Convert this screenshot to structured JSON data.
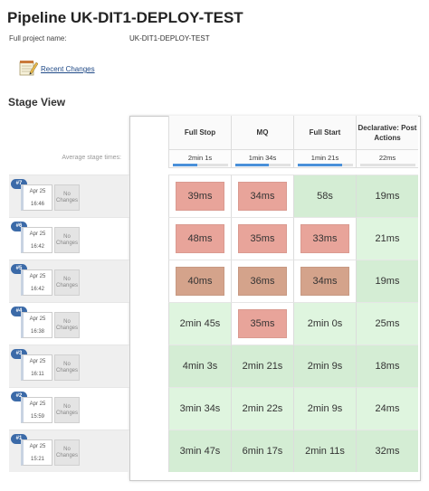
{
  "page": {
    "title": "Pipeline UK-DIT1-DEPLOY-TEST",
    "full_name_label": "Full project name:",
    "full_name_value": "UK-DIT1-DEPLOY-TEST",
    "recent_changes": "Recent Changes",
    "recent_changes_icon": "notepad-pencil-icon",
    "stage_view_heading": "Stage View",
    "avg_stage_times_label": "Average stage times:"
  },
  "colors": {
    "success": "#dff5df",
    "unstable": "#e8a49a",
    "unstable_dim": "#d4a38b",
    "progress": "#4a90d9",
    "build_badge": "#3b6aa8"
  },
  "stages": [
    {
      "name": "Full Stop",
      "avg": "2min 1s",
      "avg_fill": 0.45
    },
    {
      "name": "MQ",
      "avg": "1min 34s",
      "avg_fill": 0.6
    },
    {
      "name": "Full Start",
      "avg": "1min 21s",
      "avg_fill": 0.8
    },
    {
      "name": "Declarative: Post Actions",
      "avg": "22ms",
      "avg_fill": 0.0
    }
  ],
  "builds": [
    {
      "number": "#7",
      "date": "Apr 25",
      "time": "16:46",
      "changes": "No Changes",
      "cells": [
        {
          "value": "39ms",
          "status": "unstable"
        },
        {
          "value": "34ms",
          "status": "unstable"
        },
        {
          "value": "58s",
          "status": "success"
        },
        {
          "value": "19ms",
          "status": "success"
        }
      ]
    },
    {
      "number": "#6",
      "date": "Apr 25",
      "time": "16:42",
      "changes": "No Changes",
      "cells": [
        {
          "value": "48ms",
          "status": "unstable"
        },
        {
          "value": "35ms",
          "status": "unstable"
        },
        {
          "value": "33ms",
          "status": "unstable"
        },
        {
          "value": "21ms",
          "status": "success"
        }
      ]
    },
    {
      "number": "#5",
      "date": "Apr 25",
      "time": "16:42",
      "changes": "No Changes",
      "cells": [
        {
          "value": "40ms",
          "status": "unstable-dim"
        },
        {
          "value": "36ms",
          "status": "unstable-dim"
        },
        {
          "value": "34ms",
          "status": "unstable-dim"
        },
        {
          "value": "19ms",
          "status": "success"
        }
      ]
    },
    {
      "number": "#4",
      "date": "Apr 25",
      "time": "16:38",
      "changes": "No Changes",
      "cells": [
        {
          "value": "2min 45s",
          "status": "success"
        },
        {
          "value": "35ms",
          "status": "unstable"
        },
        {
          "value": "2min 0s",
          "status": "success"
        },
        {
          "value": "25ms",
          "status": "success"
        }
      ]
    },
    {
      "number": "#3",
      "date": "Apr 25",
      "time": "16:11",
      "changes": "No Changes",
      "cells": [
        {
          "value": "4min 3s",
          "status": "success"
        },
        {
          "value": "2min 21s",
          "status": "success"
        },
        {
          "value": "2min 9s",
          "status": "success"
        },
        {
          "value": "18ms",
          "status": "success"
        }
      ]
    },
    {
      "number": "#2",
      "date": "Apr 25",
      "time": "15:59",
      "changes": "No Changes",
      "cells": [
        {
          "value": "3min 34s",
          "status": "success"
        },
        {
          "value": "2min 22s",
          "status": "success"
        },
        {
          "value": "2min 9s",
          "status": "success"
        },
        {
          "value": "24ms",
          "status": "success"
        }
      ]
    },
    {
      "number": "#1",
      "date": "Apr 25",
      "time": "15:21",
      "changes": "No Changes",
      "cells": [
        {
          "value": "3min 47s",
          "status": "success"
        },
        {
          "value": "6min 17s",
          "status": "success"
        },
        {
          "value": "2min 11s",
          "status": "success"
        },
        {
          "value": "32ms",
          "status": "success"
        }
      ]
    }
  ]
}
